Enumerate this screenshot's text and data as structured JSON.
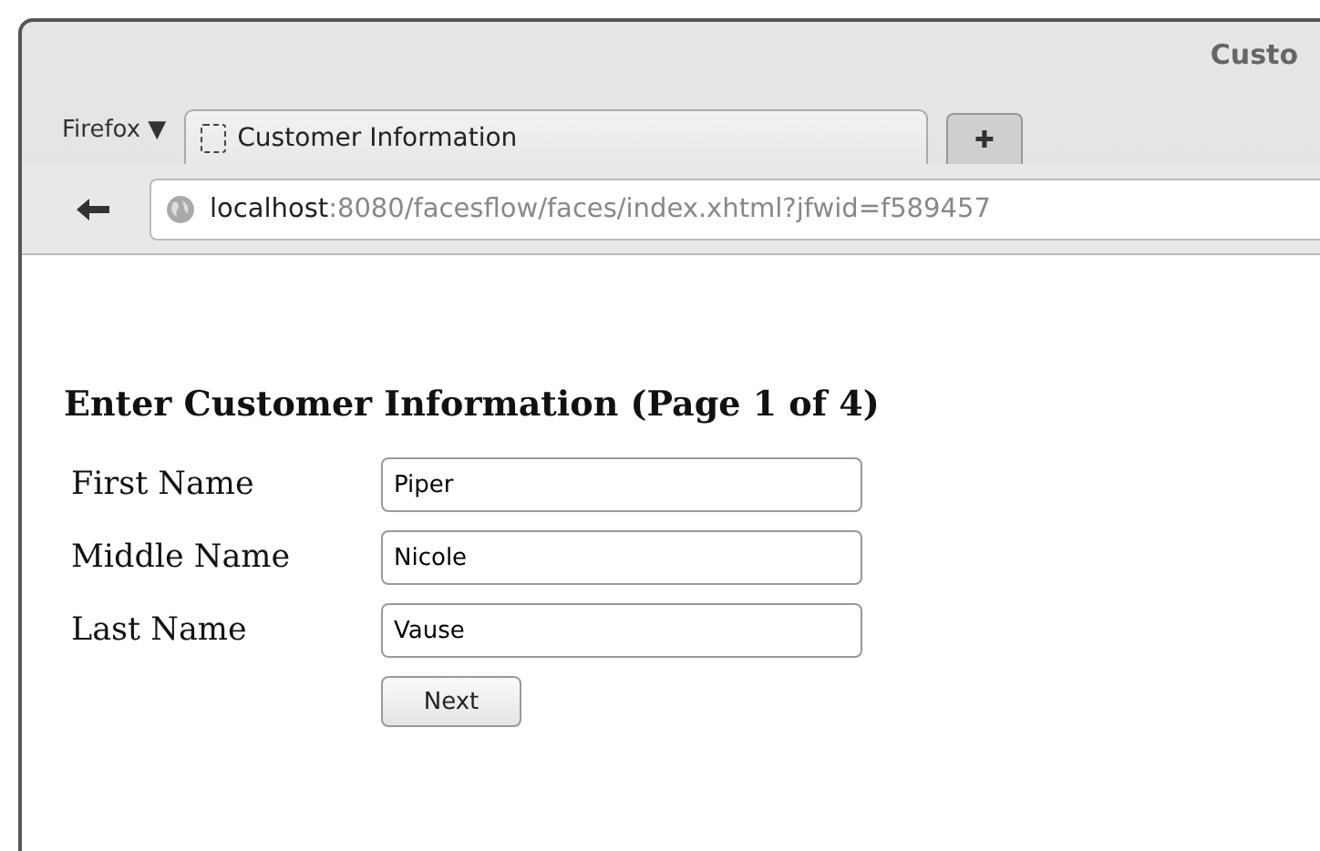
{
  "window": {
    "title": "Custo"
  },
  "browser_menu": {
    "label": "Firefox ▼"
  },
  "tabs": [
    {
      "label": "Customer Information",
      "selected": true
    }
  ],
  "new_tab": {
    "label": "✚"
  },
  "address_bar": {
    "host": "localhost",
    "rest": ":8080/facesflow/faces/index.xhtml?jfwid=f589457"
  },
  "page": {
    "heading": "Enter Customer Information (Page 1 of 4)",
    "fields": [
      {
        "label": "First Name",
        "value": "Piper"
      },
      {
        "label": "Middle Name",
        "value": "Nicole"
      },
      {
        "label": "Last Name",
        "value": "Vause"
      }
    ],
    "button": "Next"
  }
}
